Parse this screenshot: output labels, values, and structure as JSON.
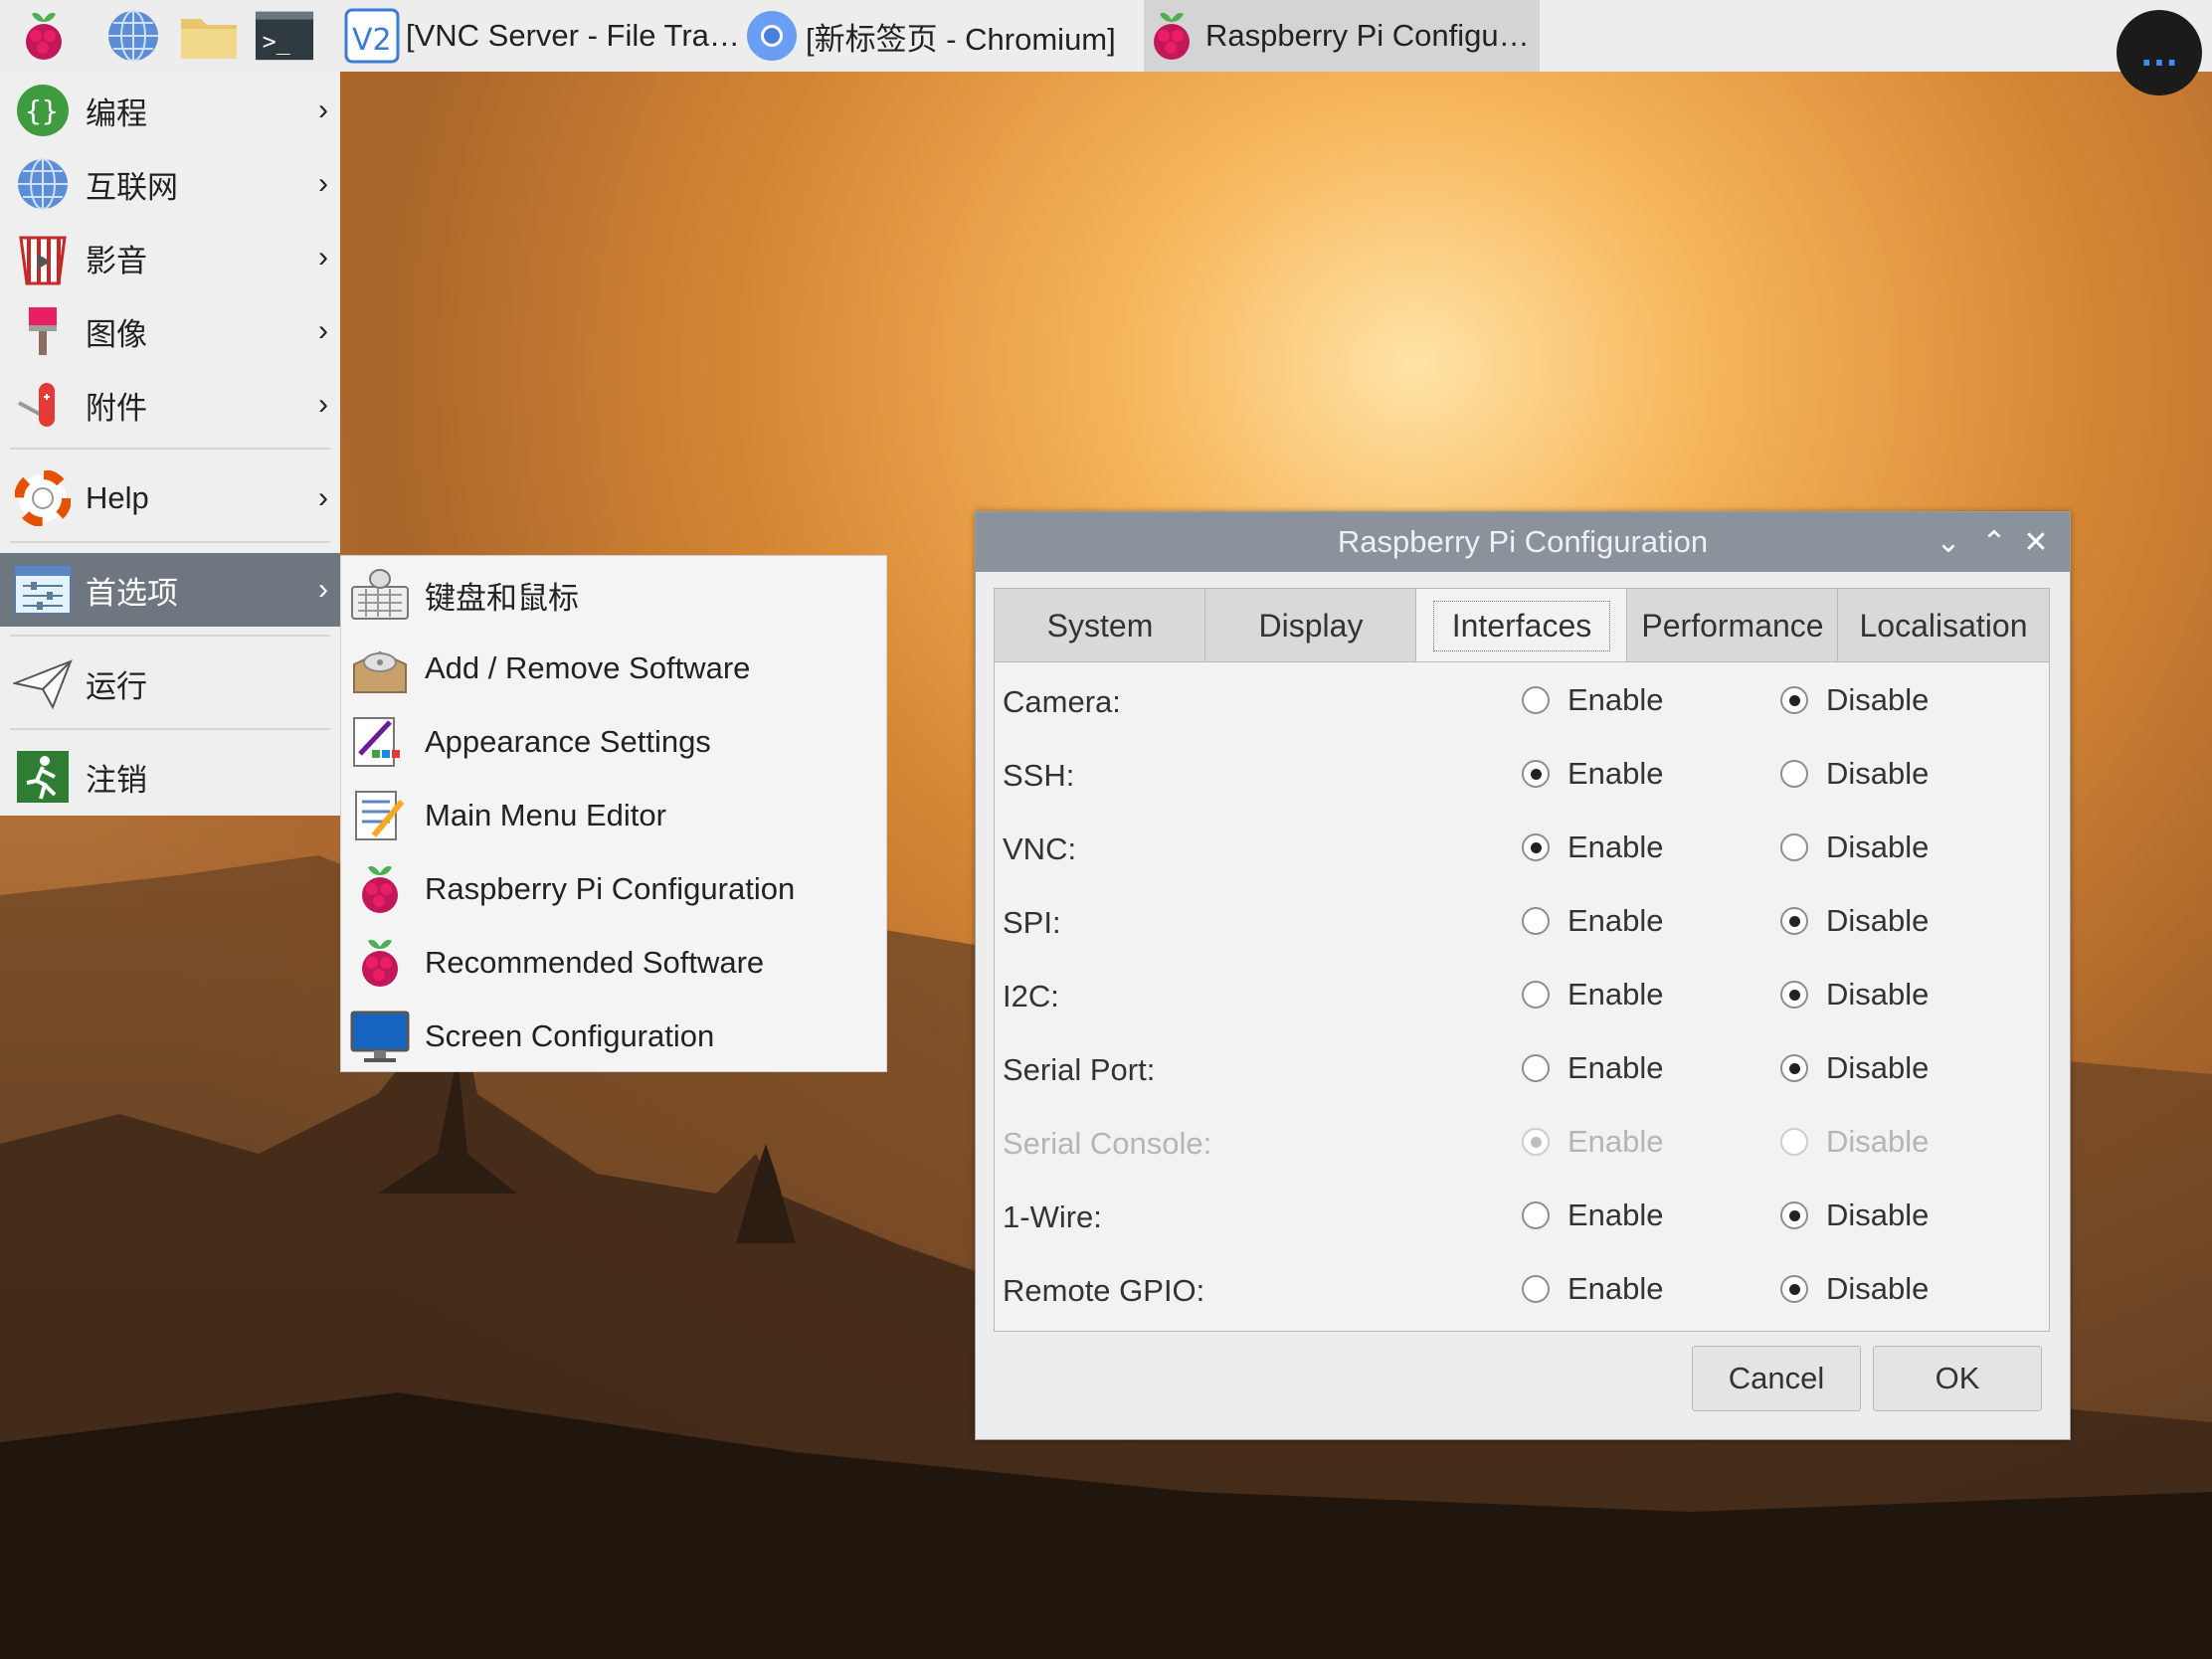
{
  "taskbar": {
    "launchers": [
      "raspberry-menu-icon",
      "web-browser-icon",
      "file-manager-icon",
      "terminal-icon"
    ],
    "tasks": [
      {
        "label": "[VNC Server - File Tra…",
        "icon": "vnc-icon"
      },
      {
        "label": "[新标签页 - Chromium]",
        "icon": "chromium-icon"
      },
      {
        "label": "Raspberry Pi Configu…",
        "icon": "raspberry-icon"
      }
    ],
    "overflow_label": "…"
  },
  "menu": {
    "items": [
      {
        "label": "编程",
        "icon": "programming-icon",
        "has_submenu": true
      },
      {
        "label": "互联网",
        "icon": "internet-icon",
        "has_submenu": true
      },
      {
        "label": "影音",
        "icon": "sound-video-icon",
        "has_submenu": true
      },
      {
        "label": "图像",
        "icon": "graphics-icon",
        "has_submenu": true
      },
      {
        "label": "附件",
        "icon": "accessories-icon",
        "has_submenu": true
      },
      {
        "label": "Help",
        "icon": "help-icon",
        "has_submenu": true
      },
      {
        "label": "首选项",
        "icon": "preferences-icon",
        "has_submenu": true,
        "selected": true
      },
      {
        "label": "运行",
        "icon": "run-icon",
        "has_submenu": false
      },
      {
        "label": "注销",
        "icon": "logout-icon",
        "has_submenu": false
      }
    ],
    "arrow": "›"
  },
  "submenu": {
    "items": [
      {
        "label": "键盘和鼠标",
        "icon": "keyboard-mouse-icon"
      },
      {
        "label": "Add / Remove Software",
        "icon": "add-remove-software-icon"
      },
      {
        "label": "Appearance Settings",
        "icon": "appearance-settings-icon"
      },
      {
        "label": "Main Menu Editor",
        "icon": "menu-editor-icon"
      },
      {
        "label": "Raspberry Pi Configuration",
        "icon": "raspberry-icon"
      },
      {
        "label": "Recommended Software",
        "icon": "raspberry-icon"
      },
      {
        "label": "Screen Configuration",
        "icon": "monitor-icon"
      }
    ]
  },
  "dialog": {
    "title": "Raspberry Pi Configuration",
    "tabs": [
      "System",
      "Display",
      "Interfaces",
      "Performance",
      "Localisation"
    ],
    "active_tab": "Interfaces",
    "enable_label": "Enable",
    "disable_label": "Disable",
    "interfaces": [
      {
        "label": "Camera:",
        "value": "Disable",
        "disabled": false
      },
      {
        "label": "SSH:",
        "value": "Enable",
        "disabled": false
      },
      {
        "label": "VNC:",
        "value": "Enable",
        "disabled": false
      },
      {
        "label": "SPI:",
        "value": "Disable",
        "disabled": false
      },
      {
        "label": "I2C:",
        "value": "Disable",
        "disabled": false
      },
      {
        "label": "Serial Port:",
        "value": "Disable",
        "disabled": false
      },
      {
        "label": "Serial Console:",
        "value": "Enable",
        "disabled": true
      },
      {
        "label": "1-Wire:",
        "value": "Disable",
        "disabled": false
      },
      {
        "label": "Remote GPIO:",
        "value": "Disable",
        "disabled": false
      }
    ],
    "cancel_label": "Cancel",
    "ok_label": "OK",
    "controls": {
      "minimize": "⌄",
      "maximize": "⌃",
      "close": "✕"
    }
  }
}
